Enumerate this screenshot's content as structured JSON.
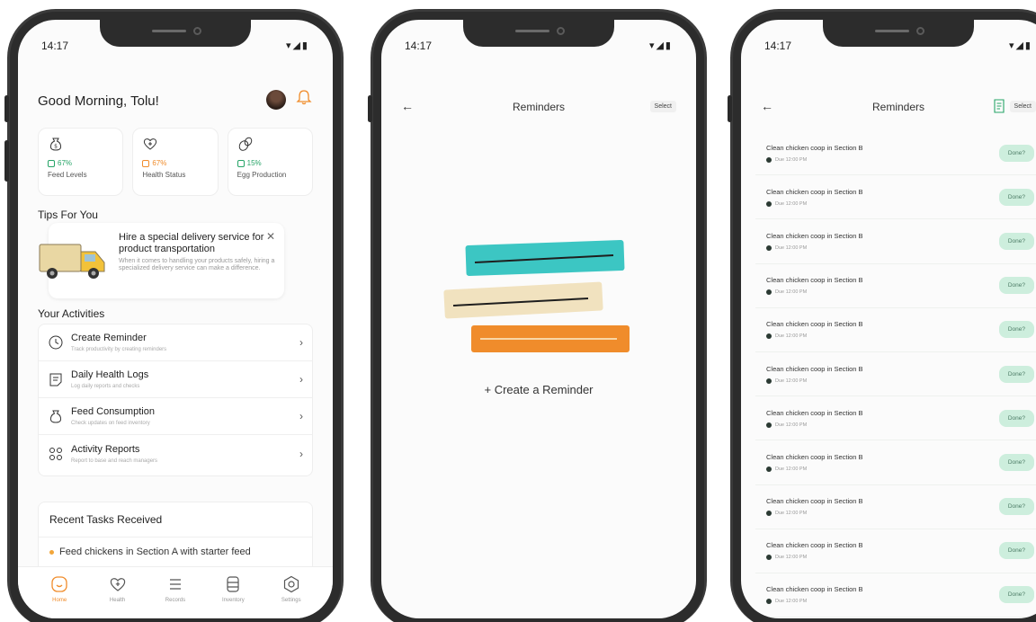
{
  "colors": {
    "accent_orange": "#f08c2b",
    "accent_green": "#26a467",
    "teal": "#3cc6c3",
    "done_bg": "#cdeedd"
  },
  "home": {
    "time": "14:17",
    "status_icons": "▾◢▮",
    "greeting": "Good Morning, Tolu!",
    "stats": [
      {
        "icon": "sack-icon",
        "pct": "67%",
        "label": "Feed Levels"
      },
      {
        "icon": "heart-plus-icon",
        "pct": "67%",
        "label": "Health Status"
      },
      {
        "icon": "egg-icon",
        "pct": "15%",
        "label": "Egg Production"
      }
    ],
    "tips_title": "Tips For You",
    "tip": {
      "title": "Hire a special delivery service for product transportation",
      "body": "When it comes to handling your products safely, hiring a specialized delivery service can make a difference.",
      "close": "✕"
    },
    "activities_title": "Your Activities",
    "activities": [
      {
        "name": "Create Reminder",
        "sub": "Track productivity by creating reminders"
      },
      {
        "name": "Daily Health Logs",
        "sub": "Log daily reports and checks"
      },
      {
        "name": "Feed Consumption",
        "sub": "Check updates on feed inventory"
      },
      {
        "name": "Activity Reports",
        "sub": "Report to base and reach managers"
      }
    ],
    "chevron": "›",
    "recent_title": "Recent Tasks Received",
    "recent_item": "Feed chickens in Section A with starter feed",
    "tabs": [
      "Home",
      "Health",
      "Records",
      "Inventory",
      "Settings"
    ]
  },
  "reminders_empty": {
    "time": "14:17",
    "back": "←",
    "title": "Reminders",
    "select": "Select",
    "create": "+ Create a Reminder"
  },
  "reminders_list": {
    "time": "14:17",
    "back": "←",
    "title": "Reminders",
    "select": "Select",
    "items": [
      {
        "name": "Clean chicken coop in Section B",
        "due": "Due 12:00 PM",
        "action": "Done?"
      },
      {
        "name": "Clean chicken coop in Section B",
        "due": "Due 12:00 PM",
        "action": "Done?"
      },
      {
        "name": "Clean chicken coop in Section B",
        "due": "Due 12:00 PM",
        "action": "Done?"
      },
      {
        "name": "Clean chicken coop in Section B",
        "due": "Due 12:00 PM",
        "action": "Done?"
      },
      {
        "name": "Clean chicken coop in Section B",
        "due": "Due 12:00 PM",
        "action": "Done?"
      },
      {
        "name": "Clean chicken coop in Section B",
        "due": "Due 12:00 PM",
        "action": "Done?"
      },
      {
        "name": "Clean chicken coop in Section B",
        "due": "Due 12:00 PM",
        "action": "Done?"
      },
      {
        "name": "Clean chicken coop in Section B",
        "due": "Due 12:00 PM",
        "action": "Done?"
      },
      {
        "name": "Clean chicken coop in Section B",
        "due": "Due 12:00 PM",
        "action": "Done?"
      },
      {
        "name": "Clean chicken coop in Section B",
        "due": "Due 12:00 PM",
        "action": "Done?"
      },
      {
        "name": "Clean chicken coop in Section B",
        "due": "Due 12:00 PM",
        "action": "Done?"
      }
    ]
  }
}
